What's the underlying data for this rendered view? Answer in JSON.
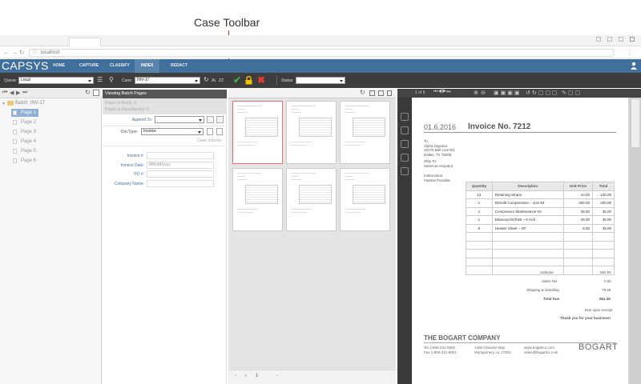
{
  "callout": {
    "label": "Case Toolbar"
  },
  "browser": {
    "url": "localhost"
  },
  "app": {
    "logo": "CAPSYS",
    "menu": [
      "HOME",
      "CAPTURE",
      "CLASSIFY",
      "INDEX",
      "REDACT"
    ],
    "active_menu": "INDEX"
  },
  "toolbar": {
    "queue_label": "Queue:",
    "queue_value": "Local",
    "case_label": "Case:",
    "case_value": "INV-17",
    "az_label": "AL",
    "zz_label": "ZZ",
    "status_label": "Status:",
    "status_value": ""
  },
  "batch": {
    "title": "Batch: INV-17",
    "pages": [
      "Page 1",
      "Page 2",
      "Page 3",
      "Page 4",
      "Page 5",
      "Page 6"
    ]
  },
  "middle": {
    "header": "Viewing Batch Pages",
    "pages_in_batch": "Pages in Batch: 6",
    "pages_in_document": "Pages in Document(s): 0",
    "append_to_label": "Append To:",
    "append_to_value": "",
    "doctype_label": "DocType:",
    "doctype_value": "Invoice",
    "clear_indexes": "Clear Indexes",
    "fields": [
      {
        "label": "Invoice #:",
        "value": "",
        "placeholder": ""
      },
      {
        "label": "Invoice Date:",
        "value": "",
        "placeholder": "MM/dd/yyyy"
      },
      {
        "label": "PO #:",
        "value": "",
        "placeholder": ""
      },
      {
        "label": "Company Name:",
        "value": "",
        "placeholder": ""
      }
    ]
  },
  "thumbs": {
    "count": 6,
    "active_index": 0
  },
  "pager": {
    "current": "1"
  },
  "viewer": {
    "page_indicator": "1 of 6"
  },
  "invoice": {
    "date": "01.6.2016",
    "title": "Invoice No. 7212",
    "to_label": "To:",
    "to_lines": [
      "Alpha Digestor",
      "16175 Bell Line Rd",
      "Dallas, TX 75038"
    ],
    "ship_label": "Ship To:",
    "ship_lines": [
      "Same as recipient"
    ],
    "instructions_label": "Instructions:",
    "instructions_lines": [
      "Fastest Possible"
    ],
    "table_headers": [
      "Quantity",
      "Description",
      "Unit Price",
      "Total"
    ],
    "rows": [
      {
        "qty": "12",
        "desc": "Retaining Straps",
        "price": "10.00",
        "total": "120.00"
      },
      {
        "qty": "1",
        "desc": "Retrofit Compression – size 50",
        "price": "200.00",
        "total": "200.00"
      },
      {
        "qty": "1",
        "desc": "Compressor Maintenance Kit",
        "price": "36.00",
        "total": "36.00"
      },
      {
        "qty": "1",
        "desc": "Diamond Drill Bit – 9 inch",
        "price": "26.00",
        "total": "26.00"
      },
      {
        "qty": "6",
        "desc": "Header Sheet – 20\"",
        "price": "6.00",
        "total": "36.00"
      }
    ],
    "empty_rows": 5,
    "subtotal_label": "Subtotal",
    "subtotal": "582.00",
    "tax_label": "Sales Tax",
    "tax": "0.00",
    "shipping_label": "Shipping & Handling",
    "shipping": "79.49",
    "total_label": "Total Due",
    "total": "661.49",
    "due_note": "Due upon receipt",
    "thanks": "Thank you for your business!",
    "company": "THE BOGART COMPANY",
    "footer_col1": [
      "Tel 1-800-221-9000",
      "Fax 1-800-221-9001"
    ],
    "footer_col2": [
      "1406 Chandel Way",
      "Montgomery, AL 27001"
    ],
    "footer_col3": [
      "www.bogartco.com",
      "sales@bogartco.com"
    ],
    "logo": "BOGART"
  }
}
